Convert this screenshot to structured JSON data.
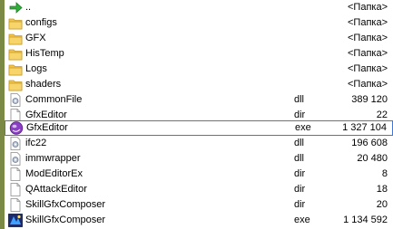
{
  "file_list": {
    "rows": [
      {
        "name": "..",
        "ext": "",
        "size": "<Папка>",
        "icon": "up-arrow-icon"
      },
      {
        "name": "configs",
        "ext": "",
        "size": "<Папка>",
        "icon": "folder-icon"
      },
      {
        "name": "GFX",
        "ext": "",
        "size": "<Папка>",
        "icon": "folder-icon"
      },
      {
        "name": "HisTemp",
        "ext": "",
        "size": "<Папка>",
        "icon": "folder-icon"
      },
      {
        "name": "Logs",
        "ext": "",
        "size": "<Папка>",
        "icon": "folder-icon"
      },
      {
        "name": "shaders",
        "ext": "",
        "size": "<Папка>",
        "icon": "folder-icon"
      },
      {
        "name": "CommonFile",
        "ext": "dll",
        "size": "389 120",
        "icon": "dll-file-icon"
      },
      {
        "name": "GfxEditor",
        "ext": "dir",
        "size": "22",
        "icon": "file-icon"
      },
      {
        "name": "GfxEditor",
        "ext": "exe",
        "size": "1 327 104",
        "icon": "gfx-editor-app-icon",
        "selected": true
      },
      {
        "name": "ifc22",
        "ext": "dll",
        "size": "196 608",
        "icon": "dll-file-icon"
      },
      {
        "name": "immwrapper",
        "ext": "dll",
        "size": "20 480",
        "icon": "dll-file-icon"
      },
      {
        "name": "ModEditorEx",
        "ext": "dir",
        "size": "8",
        "icon": "file-icon"
      },
      {
        "name": "QAttackEditor",
        "ext": "dir",
        "size": "18",
        "icon": "file-icon"
      },
      {
        "name": "SkillGfxComposer",
        "ext": "dir",
        "size": "20",
        "icon": "file-icon"
      },
      {
        "name": "SkillGfxComposer",
        "ext": "exe",
        "size": "1 134 592",
        "icon": "skill-composer-app-icon"
      }
    ]
  },
  "colors": {
    "selection_border": "#3c78d8",
    "folder": "#f2c24a",
    "left_strip": "#7a8a45"
  }
}
